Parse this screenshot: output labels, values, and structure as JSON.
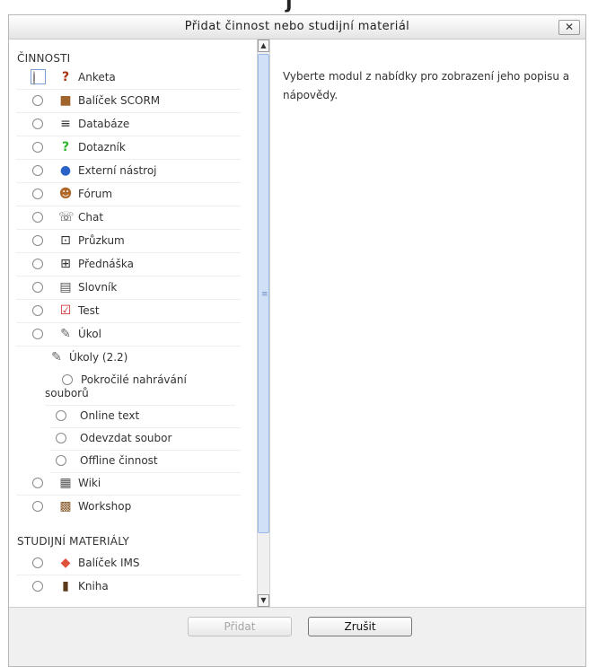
{
  "dialog": {
    "title": "Přidat činnost nebo studijní materiál",
    "close_label": "✕"
  },
  "activities": {
    "heading": "ČINNOSTI",
    "items": [
      {
        "label": "Anketa",
        "icon": "?"
      },
      {
        "label": "Balíček SCORM",
        "icon": "■"
      },
      {
        "label": "Databáze",
        "icon": "≡"
      },
      {
        "label": "Dotazník",
        "icon": "?"
      },
      {
        "label": "Externí nástroj",
        "icon": "●"
      },
      {
        "label": "Fórum",
        "icon": "☻"
      },
      {
        "label": "Chat",
        "icon": "☏"
      },
      {
        "label": "Průzkum",
        "icon": "⊡"
      },
      {
        "label": "Přednáška",
        "icon": "⊞"
      },
      {
        "label": "Slovník",
        "icon": "▤"
      },
      {
        "label": "Test",
        "icon": "☑"
      },
      {
        "label": "Úkol",
        "icon": "✎"
      }
    ],
    "assignments_group": {
      "label": "Úkoly (2.2)",
      "icon": "✎"
    },
    "sub_items": [
      {
        "label": "Pokročilé nahrávání souborů"
      },
      {
        "label": "Online text"
      },
      {
        "label": "Odevzdat soubor"
      },
      {
        "label": "Offline činnost"
      }
    ],
    "after_items": [
      {
        "label": "Wiki",
        "icon": "▦"
      },
      {
        "label": "Workshop",
        "icon": "▩"
      }
    ]
  },
  "resources": {
    "heading": "STUDIJNÍ MATERIÁLY",
    "items": [
      {
        "label": "Balíček IMS",
        "icon": "◆"
      },
      {
        "label": "Kniha",
        "icon": "▮"
      }
    ]
  },
  "help_text": "Vyberte modul z nabídky pro zobrazení jeho popisu a nápovědy.",
  "footer": {
    "add_label": "Přidat",
    "cancel_label": "Zrušit"
  }
}
